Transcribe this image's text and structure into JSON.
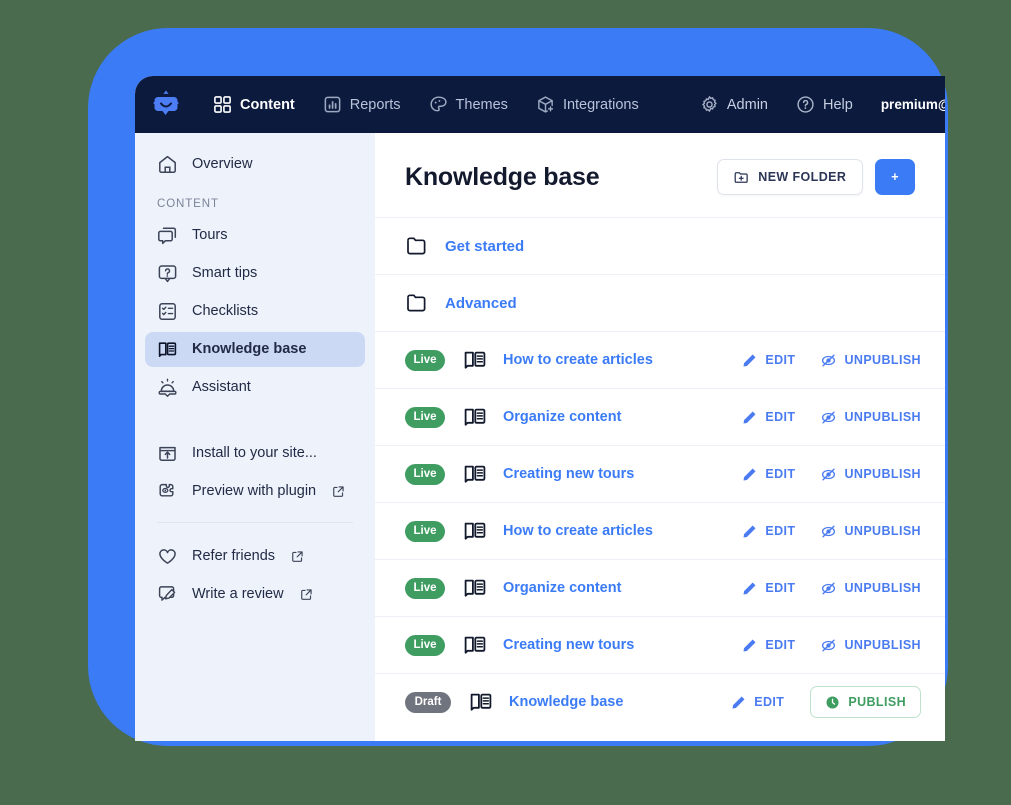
{
  "colors": {
    "scene_bg": "#4a6b4d",
    "frame_blue": "#3b7bf6",
    "navbar": "#0c1a3d",
    "sidebar_bg": "#eef2fb",
    "sidebar_active": "#ccd9f4",
    "link_blue": "#3b7bf6",
    "live_green": "#3f9d61",
    "draft_gray": "#70747e"
  },
  "topnav": {
    "logo": "robot-logo-icon",
    "items": [
      {
        "label": "Content",
        "icon": "grid-icon",
        "active": true
      },
      {
        "label": "Reports",
        "icon": "bar-chart-icon",
        "active": false
      },
      {
        "label": "Themes",
        "icon": "palette-icon",
        "active": false
      },
      {
        "label": "Integrations",
        "icon": "cube-plus-icon",
        "active": false
      }
    ],
    "right_items": [
      {
        "label": "Admin",
        "icon": "gear-icon"
      },
      {
        "label": "Help",
        "icon": "question-circle-icon"
      }
    ],
    "user_email": "premium@"
  },
  "sidebar": {
    "overview": {
      "label": "Overview",
      "icon": "home-icon"
    },
    "section_label": "CONTENT",
    "content_items": [
      {
        "label": "Tours",
        "icon": "tour-bubble-icon",
        "active": false
      },
      {
        "label": "Smart tips",
        "icon": "question-bubble-icon",
        "active": false
      },
      {
        "label": "Checklists",
        "icon": "checklist-icon",
        "active": false
      },
      {
        "label": "Knowledge base",
        "icon": "book-icon",
        "active": true
      },
      {
        "label": "Assistant",
        "icon": "assistant-icon",
        "active": false
      }
    ],
    "tool_items": [
      {
        "label": "Install to your site...",
        "icon": "install-icon",
        "external": false
      },
      {
        "label": "Preview with plugin",
        "icon": "plugin-eye-icon",
        "external": true
      }
    ],
    "footer_items": [
      {
        "label": "Refer friends",
        "icon": "heart-icon",
        "external": true
      },
      {
        "label": "Write a review",
        "icon": "review-pencil-icon",
        "external": true
      }
    ]
  },
  "main": {
    "title": "Knowledge base",
    "new_folder_label": "NEW FOLDER",
    "new_folder_icon": "folder-plus-icon",
    "new_article_label": "+",
    "rows": [
      {
        "type": "folder",
        "icon": "folder-icon",
        "title": "Get started"
      },
      {
        "type": "folder",
        "icon": "folder-icon",
        "title": "Advanced"
      },
      {
        "type": "article",
        "status": "Live",
        "icon": "book-icon",
        "title": "How to create articles",
        "actions": [
          {
            "label": "EDIT",
            "icon": "pencil-icon"
          },
          {
            "label": "UNPUBLISH",
            "icon": "eye-off-icon"
          }
        ]
      },
      {
        "type": "article",
        "status": "Live",
        "icon": "book-icon",
        "title": "Organize content",
        "actions": [
          {
            "label": "EDIT",
            "icon": "pencil-icon"
          },
          {
            "label": "UNPUBLISH",
            "icon": "eye-off-icon"
          }
        ]
      },
      {
        "type": "article",
        "status": "Live",
        "icon": "book-icon",
        "title": "Creating new tours",
        "actions": [
          {
            "label": "EDIT",
            "icon": "pencil-icon"
          },
          {
            "label": "UNPUBLISH",
            "icon": "eye-off-icon"
          }
        ]
      },
      {
        "type": "article",
        "status": "Live",
        "icon": "book-icon",
        "title": "How to create articles",
        "actions": [
          {
            "label": "EDIT",
            "icon": "pencil-icon"
          },
          {
            "label": "UNPUBLISH",
            "icon": "eye-off-icon"
          }
        ]
      },
      {
        "type": "article",
        "status": "Live",
        "icon": "book-icon",
        "title": "Organize content",
        "actions": [
          {
            "label": "EDIT",
            "icon": "pencil-icon"
          },
          {
            "label": "UNPUBLISH",
            "icon": "eye-off-icon"
          }
        ]
      },
      {
        "type": "article",
        "status": "Live",
        "icon": "book-icon",
        "title": "Creating new tours",
        "actions": [
          {
            "label": "EDIT",
            "icon": "pencil-icon"
          },
          {
            "label": "UNPUBLISH",
            "icon": "eye-off-icon"
          }
        ]
      },
      {
        "type": "article",
        "status": "Draft",
        "icon": "book-icon",
        "title": "Knowledge base",
        "actions": [
          {
            "label": "EDIT",
            "icon": "pencil-icon"
          },
          {
            "label": "PUBLISH",
            "icon": "publish-clock-icon",
            "style": "outline-green"
          }
        ]
      }
    ]
  }
}
